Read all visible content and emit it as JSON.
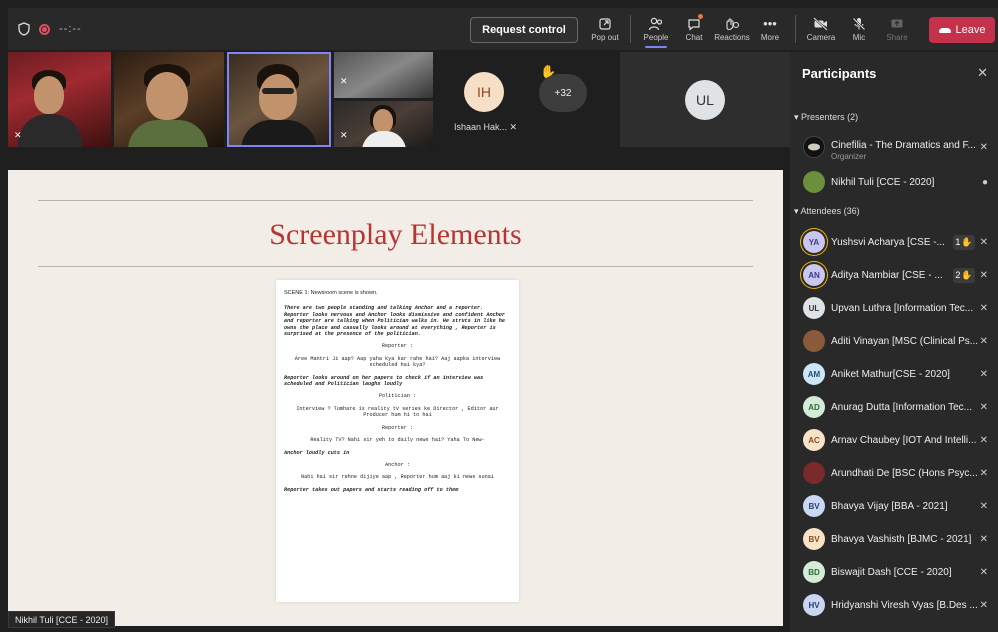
{
  "topbar": {
    "timer": "--:--",
    "request_control": "Request control",
    "tools": [
      {
        "label": "Pop out",
        "icon": "pop-out-icon"
      },
      {
        "label": "People",
        "icon": "people-icon"
      },
      {
        "label": "Chat",
        "icon": "chat-icon"
      },
      {
        "label": "Reactions",
        "icon": "reactions-icon"
      },
      {
        "label": "More",
        "icon": "more-icon"
      }
    ],
    "camera": "Camera",
    "mic": "Mic",
    "share": "Share",
    "leave": "Leave"
  },
  "strip": {
    "ih_initials": "IH",
    "ih_name": "Ishaan Hak...",
    "more_count": "+32",
    "ul_initials": "UL"
  },
  "share": {
    "title": "Screenplay Elements",
    "doc": {
      "scene": "SCENE 1: Newsroom scene is shown.",
      "action1": "There are two people standing and talking Anchor and a reporter. Reporter looks nervous and Anchor looks dismissive and confident Anchor and reporter are talking when Politician walks in. He struts in like he owns the place and casually looks around at everything , Reporter is surprised at the presence of the politician.",
      "char1": "Reporter :",
      "dial1": "Aree Mantri Ji aap? Aap yaha kya kar rahe hai? Aaj aapka interview scheduled hai kya?",
      "action2": "Reporter looks around on her papers to check if an interview was scheduled and Politician laughs loudly",
      "char2": "Politician :",
      "dial2": "Interview ? Tumhare is reality tv series ke Director , Editor aur Producer hum hi to hai",
      "char3": "Reporter :",
      "dial3": "Reality TV? Nahi sir yeh to daily news hai? Yaha To New-",
      "action3": "Anchor loudly cuts in",
      "char4": "Anchor :",
      "dial4": "Nahi hai sir rehne dijiye aap , Reporter hum aaj ki news sunai",
      "action4": "Reporter takes out papers and starts reading off to them"
    },
    "caption": "Nikhil Tuli [CCE - 2020]"
  },
  "panel": {
    "title": "Participants",
    "presenters_header": "Presenters (2)",
    "attendees_header": "Attendees (36)",
    "presenters": [
      {
        "name": "Cinefilia - The Dramatics and F...",
        "role": "Organizer"
      },
      {
        "name": "Nikhil Tuli [CCE - 2020]"
      }
    ],
    "attendees": [
      {
        "initials": "YA",
        "name": "Yushsvi Acharya [CSE -...",
        "hand": "1",
        "color": "#c9c6ef",
        "fg": "#3c3a8a"
      },
      {
        "initials": "AN",
        "name": "Aditya Nambiar [CSE - ...",
        "hand": "2",
        "color": "#c9c6ef",
        "fg": "#3c3a8a"
      },
      {
        "initials": "UL",
        "name": "Upvan Luthra [Information Tec...",
        "color": "#dfe3e6",
        "fg": "#333333"
      },
      {
        "initials": "",
        "name": "Aditi Vinayan [MSC (Clinical Ps...",
        "color": "#8a5a3a",
        "fg": "#ffffff"
      },
      {
        "initials": "AM",
        "name": "Aniket Mathur[CSE - 2020]",
        "color": "#cde6f7",
        "fg": "#1f4f73"
      },
      {
        "initials": "AD",
        "name": "Anurag Dutta [Information Tec...",
        "color": "#d3ecd8",
        "fg": "#2e6b3a"
      },
      {
        "initials": "AC",
        "name": "Arnav Chaubey [IOT And Intelli...",
        "color": "#f9e3c8",
        "fg": "#8a4b1d"
      },
      {
        "initials": "",
        "name": "Arundhati De [BSC (Hons Psyc...",
        "color": "#7a2a2a",
        "fg": "#ffffff"
      },
      {
        "initials": "BV",
        "name": "Bhavya Vijay [BBA - 2021]",
        "color": "#c9d7f2",
        "fg": "#2a3f73"
      },
      {
        "initials": "BV",
        "name": "Bhavya Vashisth [BJMC - 2021]",
        "color": "#f9e3c8",
        "fg": "#8a4b1d"
      },
      {
        "initials": "BD",
        "name": "Biswajit Dash [CCE - 2020]",
        "color": "#d3ecd8",
        "fg": "#2e6b3a"
      },
      {
        "initials": "HV",
        "name": "Hridyanshi Viresh Vyas [B.Des ...",
        "color": "#c9d7f2",
        "fg": "#2a3f73"
      }
    ]
  }
}
